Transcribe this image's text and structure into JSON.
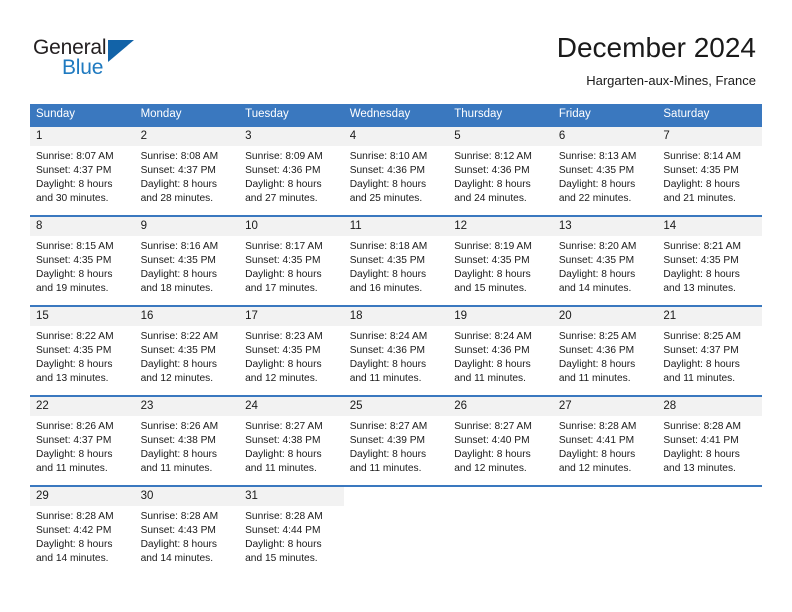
{
  "brand": {
    "name_top": "General",
    "name_bottom": "Blue",
    "triangle_color": "#1263a8",
    "blue_text_color": "#1f7ac0"
  },
  "header": {
    "title": "December 2024",
    "subtitle": "Hargarten-aux-Mines, France"
  },
  "theme": {
    "header_blue": "#3a78bf",
    "daynum_bg": "#f2f2f2"
  },
  "weekdays": [
    "Sunday",
    "Monday",
    "Tuesday",
    "Wednesday",
    "Thursday",
    "Friday",
    "Saturday"
  ],
  "weeks": [
    [
      {
        "day": "1",
        "sunrise": "Sunrise: 8:07 AM",
        "sunset": "Sunset: 4:37 PM",
        "daylight1": "Daylight: 8 hours",
        "daylight2": "and 30 minutes."
      },
      {
        "day": "2",
        "sunrise": "Sunrise: 8:08 AM",
        "sunset": "Sunset: 4:37 PM",
        "daylight1": "Daylight: 8 hours",
        "daylight2": "and 28 minutes."
      },
      {
        "day": "3",
        "sunrise": "Sunrise: 8:09 AM",
        "sunset": "Sunset: 4:36 PM",
        "daylight1": "Daylight: 8 hours",
        "daylight2": "and 27 minutes."
      },
      {
        "day": "4",
        "sunrise": "Sunrise: 8:10 AM",
        "sunset": "Sunset: 4:36 PM",
        "daylight1": "Daylight: 8 hours",
        "daylight2": "and 25 minutes."
      },
      {
        "day": "5",
        "sunrise": "Sunrise: 8:12 AM",
        "sunset": "Sunset: 4:36 PM",
        "daylight1": "Daylight: 8 hours",
        "daylight2": "and 24 minutes."
      },
      {
        "day": "6",
        "sunrise": "Sunrise: 8:13 AM",
        "sunset": "Sunset: 4:35 PM",
        "daylight1": "Daylight: 8 hours",
        "daylight2": "and 22 minutes."
      },
      {
        "day": "7",
        "sunrise": "Sunrise: 8:14 AM",
        "sunset": "Sunset: 4:35 PM",
        "daylight1": "Daylight: 8 hours",
        "daylight2": "and 21 minutes."
      }
    ],
    [
      {
        "day": "8",
        "sunrise": "Sunrise: 8:15 AM",
        "sunset": "Sunset: 4:35 PM",
        "daylight1": "Daylight: 8 hours",
        "daylight2": "and 19 minutes."
      },
      {
        "day": "9",
        "sunrise": "Sunrise: 8:16 AM",
        "sunset": "Sunset: 4:35 PM",
        "daylight1": "Daylight: 8 hours",
        "daylight2": "and 18 minutes."
      },
      {
        "day": "10",
        "sunrise": "Sunrise: 8:17 AM",
        "sunset": "Sunset: 4:35 PM",
        "daylight1": "Daylight: 8 hours",
        "daylight2": "and 17 minutes."
      },
      {
        "day": "11",
        "sunrise": "Sunrise: 8:18 AM",
        "sunset": "Sunset: 4:35 PM",
        "daylight1": "Daylight: 8 hours",
        "daylight2": "and 16 minutes."
      },
      {
        "day": "12",
        "sunrise": "Sunrise: 8:19 AM",
        "sunset": "Sunset: 4:35 PM",
        "daylight1": "Daylight: 8 hours",
        "daylight2": "and 15 minutes."
      },
      {
        "day": "13",
        "sunrise": "Sunrise: 8:20 AM",
        "sunset": "Sunset: 4:35 PM",
        "daylight1": "Daylight: 8 hours",
        "daylight2": "and 14 minutes."
      },
      {
        "day": "14",
        "sunrise": "Sunrise: 8:21 AM",
        "sunset": "Sunset: 4:35 PM",
        "daylight1": "Daylight: 8 hours",
        "daylight2": "and 13 minutes."
      }
    ],
    [
      {
        "day": "15",
        "sunrise": "Sunrise: 8:22 AM",
        "sunset": "Sunset: 4:35 PM",
        "daylight1": "Daylight: 8 hours",
        "daylight2": "and 13 minutes."
      },
      {
        "day": "16",
        "sunrise": "Sunrise: 8:22 AM",
        "sunset": "Sunset: 4:35 PM",
        "daylight1": "Daylight: 8 hours",
        "daylight2": "and 12 minutes."
      },
      {
        "day": "17",
        "sunrise": "Sunrise: 8:23 AM",
        "sunset": "Sunset: 4:35 PM",
        "daylight1": "Daylight: 8 hours",
        "daylight2": "and 12 minutes."
      },
      {
        "day": "18",
        "sunrise": "Sunrise: 8:24 AM",
        "sunset": "Sunset: 4:36 PM",
        "daylight1": "Daylight: 8 hours",
        "daylight2": "and 11 minutes."
      },
      {
        "day": "19",
        "sunrise": "Sunrise: 8:24 AM",
        "sunset": "Sunset: 4:36 PM",
        "daylight1": "Daylight: 8 hours",
        "daylight2": "and 11 minutes."
      },
      {
        "day": "20",
        "sunrise": "Sunrise: 8:25 AM",
        "sunset": "Sunset: 4:36 PM",
        "daylight1": "Daylight: 8 hours",
        "daylight2": "and 11 minutes."
      },
      {
        "day": "21",
        "sunrise": "Sunrise: 8:25 AM",
        "sunset": "Sunset: 4:37 PM",
        "daylight1": "Daylight: 8 hours",
        "daylight2": "and 11 minutes."
      }
    ],
    [
      {
        "day": "22",
        "sunrise": "Sunrise: 8:26 AM",
        "sunset": "Sunset: 4:37 PM",
        "daylight1": "Daylight: 8 hours",
        "daylight2": "and 11 minutes."
      },
      {
        "day": "23",
        "sunrise": "Sunrise: 8:26 AM",
        "sunset": "Sunset: 4:38 PM",
        "daylight1": "Daylight: 8 hours",
        "daylight2": "and 11 minutes."
      },
      {
        "day": "24",
        "sunrise": "Sunrise: 8:27 AM",
        "sunset": "Sunset: 4:38 PM",
        "daylight1": "Daylight: 8 hours",
        "daylight2": "and 11 minutes."
      },
      {
        "day": "25",
        "sunrise": "Sunrise: 8:27 AM",
        "sunset": "Sunset: 4:39 PM",
        "daylight1": "Daylight: 8 hours",
        "daylight2": "and 11 minutes."
      },
      {
        "day": "26",
        "sunrise": "Sunrise: 8:27 AM",
        "sunset": "Sunset: 4:40 PM",
        "daylight1": "Daylight: 8 hours",
        "daylight2": "and 12 minutes."
      },
      {
        "day": "27",
        "sunrise": "Sunrise: 8:28 AM",
        "sunset": "Sunset: 4:41 PM",
        "daylight1": "Daylight: 8 hours",
        "daylight2": "and 12 minutes."
      },
      {
        "day": "28",
        "sunrise": "Sunrise: 8:28 AM",
        "sunset": "Sunset: 4:41 PM",
        "daylight1": "Daylight: 8 hours",
        "daylight2": "and 13 minutes."
      }
    ],
    [
      {
        "day": "29",
        "sunrise": "Sunrise: 8:28 AM",
        "sunset": "Sunset: 4:42 PM",
        "daylight1": "Daylight: 8 hours",
        "daylight2": "and 14 minutes."
      },
      {
        "day": "30",
        "sunrise": "Sunrise: 8:28 AM",
        "sunset": "Sunset: 4:43 PM",
        "daylight1": "Daylight: 8 hours",
        "daylight2": "and 14 minutes."
      },
      {
        "day": "31",
        "sunrise": "Sunrise: 8:28 AM",
        "sunset": "Sunset: 4:44 PM",
        "daylight1": "Daylight: 8 hours",
        "daylight2": "and 15 minutes."
      },
      {
        "day": "",
        "sunrise": "",
        "sunset": "",
        "daylight1": "",
        "daylight2": ""
      },
      {
        "day": "",
        "sunrise": "",
        "sunset": "",
        "daylight1": "",
        "daylight2": ""
      },
      {
        "day": "",
        "sunrise": "",
        "sunset": "",
        "daylight1": "",
        "daylight2": ""
      },
      {
        "day": "",
        "sunrise": "",
        "sunset": "",
        "daylight1": "",
        "daylight2": ""
      }
    ]
  ]
}
